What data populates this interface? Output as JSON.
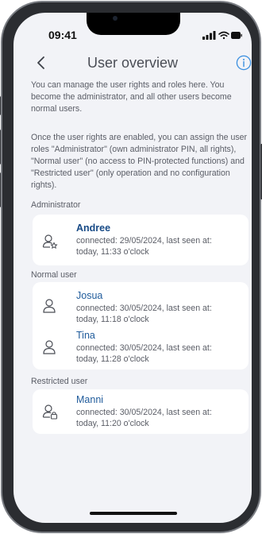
{
  "status": {
    "time": "09:41"
  },
  "nav": {
    "title": "User overview"
  },
  "intro": {
    "p1": "You can manage the user rights and roles here. You become the administrator, and all other users become normal users.",
    "p2": "Once the user rights are enabled, you can assign the user roles \"Administrator\" (own administrator PIN, all rights), \"Normal user\" (no access to PIN-protected functions) and \"Restricted user\" (only operation and no configuration rights)."
  },
  "sections": {
    "administrator": {
      "label": "Administrator",
      "users": [
        {
          "name": "Andree",
          "detail": "connected: 29/05/2024, last seen at: today, 11:33 o'clock",
          "icon": "user-star-icon"
        }
      ]
    },
    "normal": {
      "label": "Normal user",
      "users": [
        {
          "name": "Josua",
          "detail": "connected: 30/05/2024, last seen at: today, 11:18 o'clock",
          "icon": "user-icon"
        },
        {
          "name": "Tina",
          "detail": "connected: 30/05/2024, last seen at: today, 11:28 o'clock",
          "icon": "user-icon"
        }
      ]
    },
    "restricted": {
      "label": "Restricted user",
      "users": [
        {
          "name": "Manni",
          "detail": "connected: 30/05/2024, last seen at: today, 11:20 o'clock",
          "icon": "user-lock-icon"
        }
      ]
    }
  },
  "colors": {
    "accent": "#1f5b9b",
    "info": "#3a8fe0",
    "background": "#f2f3f7"
  }
}
